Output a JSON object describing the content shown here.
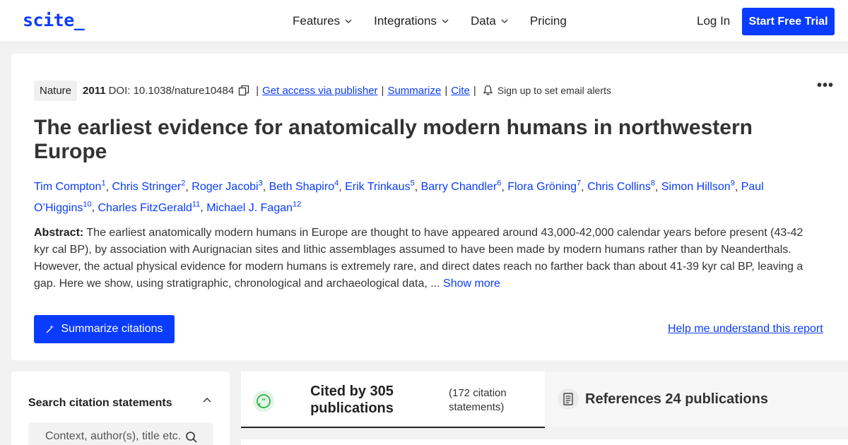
{
  "header": {
    "logo": "scite_",
    "nav": [
      {
        "label": "Features",
        "dropdown": true
      },
      {
        "label": "Integrations",
        "dropdown": true
      },
      {
        "label": "Data",
        "dropdown": true
      },
      {
        "label": "Pricing",
        "dropdown": false
      }
    ],
    "login": "Log In",
    "trial": "Start Free Trial"
  },
  "paper": {
    "journal": "Nature",
    "year": "2011",
    "doi": "DOI: 10.1038/nature10484",
    "links": [
      "Get access via publisher",
      "Summarize",
      "Cite"
    ],
    "alerts": "Sign up to set email alerts",
    "title": "The earliest evidence for anatomically modern humans in northwestern Europe",
    "authors": [
      {
        "name": "Tim Compton",
        "num": "1"
      },
      {
        "name": "Chris Stringer",
        "num": "2"
      },
      {
        "name": "Roger Jacobi",
        "num": "3"
      },
      {
        "name": "Beth Shapiro",
        "num": "4"
      },
      {
        "name": "Erik Trinkaus",
        "num": "5"
      },
      {
        "name": "Barry Chandler",
        "num": "6"
      },
      {
        "name": "Flora Gröning",
        "num": "7"
      },
      {
        "name": "Chris Collins",
        "num": "8"
      },
      {
        "name": "Simon Hillson",
        "num": "9"
      },
      {
        "name": "Paul O’Higgins",
        "num": "10"
      },
      {
        "name": "Charles FitzGerald",
        "num": "11"
      },
      {
        "name": "Michael J. Fagan",
        "num": "12"
      }
    ],
    "abstract_label": "Abstract:",
    "abstract": " The earliest anatomically modern humans in Europe are thought to have appeared around 43,000-42,000 calendar years before present (43-42 kyr cal BP), by association with Aurignacian sites and lithic assemblages assumed to have been made by modern humans rather than by Neanderthals. However, the actual physical evidence for modern humans is extremely rare, and direct dates reach no farther back than about 41-39 kyr cal BP, leaving a gap. Here we show, using stratigraphic, chronological and archaeological data, ... ",
    "show_more": "Show more",
    "summarize_button": "Summarize citations",
    "help_link": "Help me understand this report"
  },
  "citations": {
    "panel_title": "Search citation statements",
    "search_placeholder": "Context, author(s), title etc.",
    "cited_by": "Cited by 305 publications",
    "cited_sub": "(172 citation statements)",
    "references": "References 24 publications"
  },
  "colors": {
    "accent": "#0a3cff",
    "quote_green": "#2fb344"
  }
}
